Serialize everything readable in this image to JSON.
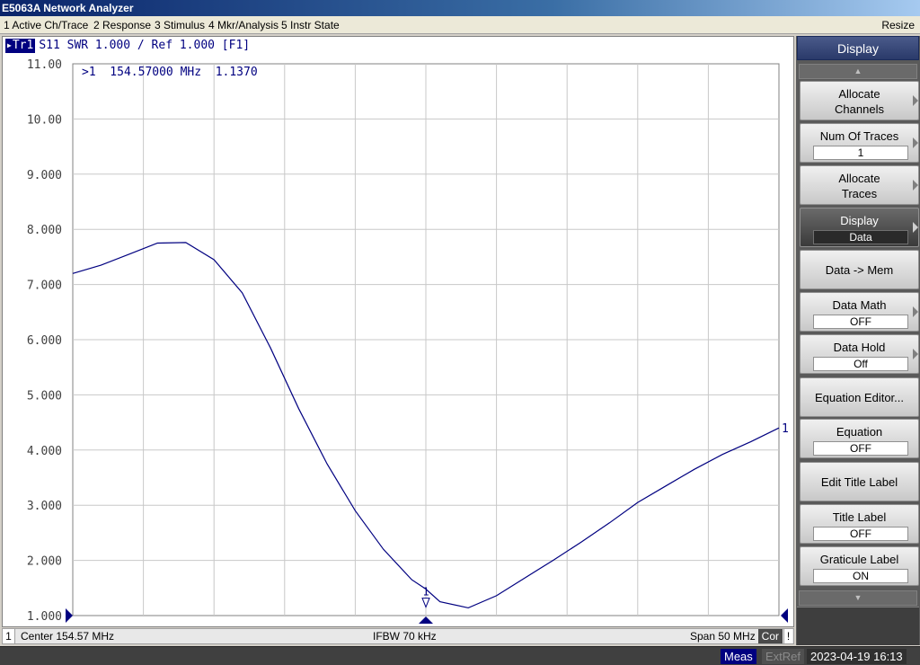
{
  "window": {
    "title": "E5063A Network Analyzer",
    "resize_label": "Resize"
  },
  "menu": [
    "1 Active Ch/Trace",
    "2 Response",
    "3 Stimulus",
    "4 Mkr/Analysis",
    "5 Instr State"
  ],
  "trace_header": {
    "tag": "Tr1",
    "text": "S11  SWR 1.000 / Ref 1.000  [F1]"
  },
  "marker_readout": ">1  154.57000 MHz  1.1370",
  "footer": {
    "channel": "1",
    "center": "Center  154.57 MHz",
    "ifbw": "IFBW 70 kHz",
    "span": "Span 50 MHz",
    "cor": "Cor",
    "flag": "!"
  },
  "status": {
    "meas": "Meas",
    "extref": "ExtRef",
    "datetime": "2023-04-19 16:13"
  },
  "softkeys": {
    "title": "Display",
    "items": [
      {
        "label": "Allocate\nChannels",
        "value": null,
        "arrow": true,
        "active": false
      },
      {
        "label": "Num Of Traces",
        "value": "1",
        "arrow": true,
        "active": false
      },
      {
        "label": "Allocate\nTraces",
        "value": null,
        "arrow": true,
        "active": false
      },
      {
        "label": "Display",
        "value": "Data",
        "arrow": true,
        "active": true
      },
      {
        "label": "Data -> Mem",
        "value": null,
        "arrow": false,
        "active": false
      },
      {
        "label": "Data Math",
        "value": "OFF",
        "arrow": true,
        "active": false
      },
      {
        "label": "Data Hold",
        "value": "Off",
        "arrow": true,
        "active": false
      },
      {
        "label": "Equation Editor...",
        "value": null,
        "arrow": false,
        "active": false
      },
      {
        "label": "Equation",
        "value": "OFF",
        "arrow": false,
        "active": false
      },
      {
        "label": "Edit Title Label",
        "value": null,
        "arrow": false,
        "active": false
      },
      {
        "label": "Title Label",
        "value": "OFF",
        "arrow": false,
        "active": false
      },
      {
        "label": "Graticule Label",
        "value": "ON",
        "arrow": false,
        "active": false
      }
    ]
  },
  "colors": {
    "trace": "#000080",
    "grid": "#c8c8c8",
    "background": "#ffffff",
    "menu_bg": "#ece9d8",
    "softkey_bg": "#5a5a5a"
  },
  "chart_data": {
    "type": "line",
    "xlabel": "",
    "ylabel": "",
    "xlim": [
      129.57,
      179.57
    ],
    "ylim": [
      1.0,
      11.0
    ],
    "y_ticks": [
      "1.000",
      "2.000",
      "3.000",
      "4.000",
      "5.000",
      "6.000",
      "7.000",
      "8.000",
      "9.000",
      "10.00",
      "11.00"
    ],
    "grid": true,
    "series": [
      {
        "x": [
          129.57,
          131.57,
          133.57,
          135.57,
          137.57,
          139.57,
          141.57,
          143.57,
          145.57,
          147.57,
          149.57,
          151.57,
          153.57,
          154.57,
          155.57,
          157.57,
          159.57,
          161.57,
          163.57,
          165.57,
          167.57,
          169.57,
          171.57,
          173.57,
          175.57,
          177.57,
          179.57
        ],
        "values": [
          7.2,
          7.35,
          7.55,
          7.75,
          7.76,
          7.45,
          6.85,
          5.85,
          4.75,
          3.75,
          2.9,
          2.2,
          1.65,
          1.48,
          1.25,
          1.14,
          1.36,
          1.68,
          2.0,
          2.33,
          2.68,
          3.05,
          3.35,
          3.65,
          3.92,
          4.15,
          4.4
        ]
      }
    ],
    "markers": [
      {
        "label": "1",
        "x": 154.57,
        "y": 1.137
      }
    ],
    "ref_level": 1.0,
    "end_label": "1"
  }
}
